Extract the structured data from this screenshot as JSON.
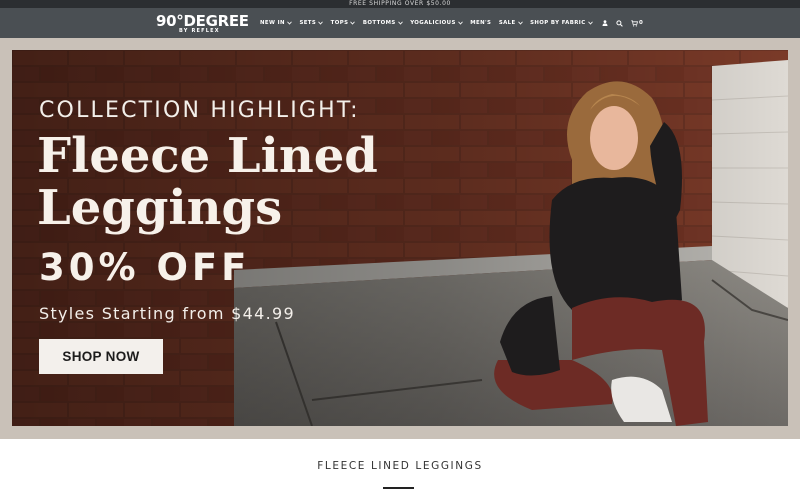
{
  "announcement": "FREE SHIPPING OVER $50.00",
  "logo": {
    "main": "90°DEGREE",
    "sub": "BY REFLEX"
  },
  "nav": [
    {
      "label": "NEW IN",
      "dropdown": true
    },
    {
      "label": "SETS",
      "dropdown": true
    },
    {
      "label": "TOPS",
      "dropdown": true
    },
    {
      "label": "BOTTOMS",
      "dropdown": true
    },
    {
      "label": "YOGALICIOUS",
      "dropdown": true
    },
    {
      "label": "MEN'S",
      "dropdown": false
    },
    {
      "label": "SALE",
      "dropdown": true
    },
    {
      "label": "SHOP BY FABRIC",
      "dropdown": true
    }
  ],
  "header_icons": {
    "account": "user-icon",
    "search": "search-icon",
    "cart": "cart-icon",
    "cart_count": "0"
  },
  "hero": {
    "eyebrow": "COLLECTION HIGHLIGHT:",
    "title_line1": "Fleece Lined",
    "title_line2": "Leggings",
    "offer": "30% OFF",
    "subtitle": "Styles Starting from $44.99",
    "cta": "SHOP NOW"
  },
  "section": {
    "title": "FLEECE LINED LEGGINGS"
  },
  "colors": {
    "announcement_bg": "#2b2e31",
    "header_bg": "#4a4f53",
    "frame_bg": "#c9c1b8",
    "cta_bg": "#f3f0ec",
    "text_light": "#f7f1ea"
  }
}
